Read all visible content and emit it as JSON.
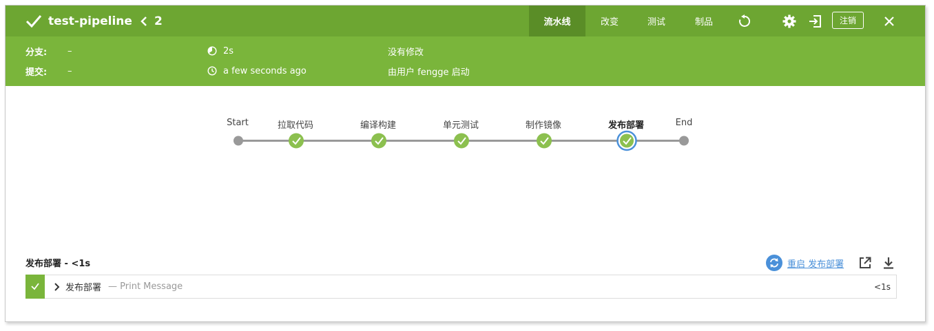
{
  "header": {
    "title": "test-pipeline",
    "run_number": "2",
    "tabs": [
      {
        "label": "流水线",
        "active": true
      },
      {
        "label": "改变",
        "active": false
      },
      {
        "label": "测试",
        "active": false
      },
      {
        "label": "制品",
        "active": false
      }
    ],
    "icons": [
      "check-icon",
      "chevron-left-icon",
      "replay-icon",
      "gear-icon",
      "exit-icon",
      "close-icon"
    ],
    "logout_label": "注销",
    "colors": {
      "header": "#6da632",
      "active_tab": "#5a8d27",
      "subheader": "#7ab53b"
    }
  },
  "summary": {
    "branch_label": "分支:",
    "branch_value": "–",
    "commit_label": "提交:",
    "commit_value": "–",
    "duration": "2s",
    "started": "a few seconds ago",
    "changes": "没有修改",
    "triggered_by": "由用户 fengge 启动"
  },
  "pipeline": {
    "stages": [
      {
        "label": "Start",
        "type": "endpoint"
      },
      {
        "label": "拉取代码",
        "status": "success"
      },
      {
        "label": "编译构建",
        "status": "success"
      },
      {
        "label": "单元测试",
        "status": "success"
      },
      {
        "label": "制作镜像",
        "status": "success"
      },
      {
        "label": "发布部署",
        "status": "success",
        "selected": true
      },
      {
        "label": "End",
        "type": "endpoint"
      }
    ],
    "colors": {
      "success": "#8cc04f",
      "selected_ring": "#4a90d9",
      "line": "#999999"
    }
  },
  "step_section": {
    "title": "发布部署 - <1s",
    "restart_label": "重启 发布部署",
    "steps": [
      {
        "name": "发布部署",
        "description": "— Print Message",
        "duration": "<1s",
        "status": "success"
      }
    ]
  }
}
